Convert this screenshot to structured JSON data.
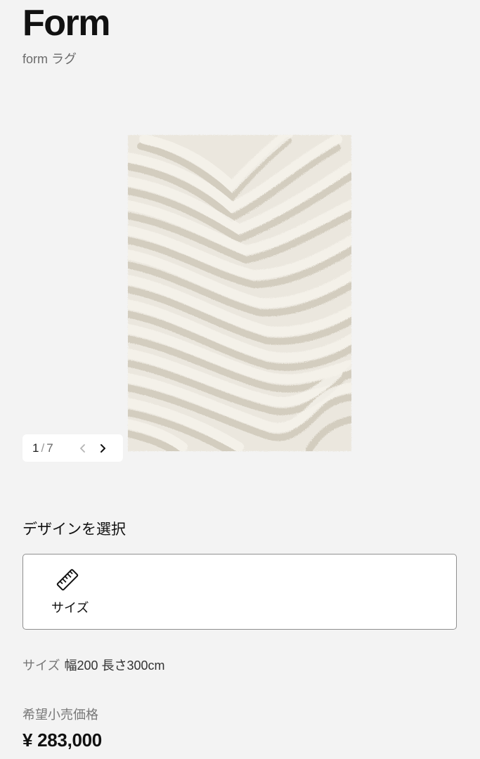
{
  "product": {
    "title": "Form",
    "subtitle": "form ラグ"
  },
  "gallery": {
    "current": "1",
    "separator": "/",
    "total": "7",
    "prev_icon": "chevron-left-icon",
    "next_icon": "chevron-right-icon",
    "image_icon": "rug-image"
  },
  "design": {
    "heading": "デザインを選択",
    "options": [
      {
        "label": "サイズ",
        "icon": "ruler-icon"
      }
    ]
  },
  "size": {
    "label": "サイズ",
    "value": "幅200 長さ300cm"
  },
  "price": {
    "label": "希望小売価格",
    "value": "¥ 283,000"
  },
  "colors": {
    "background": "#f3f3f3",
    "rug": "#e8e4db",
    "text": "#111111",
    "muted": "#777777"
  }
}
